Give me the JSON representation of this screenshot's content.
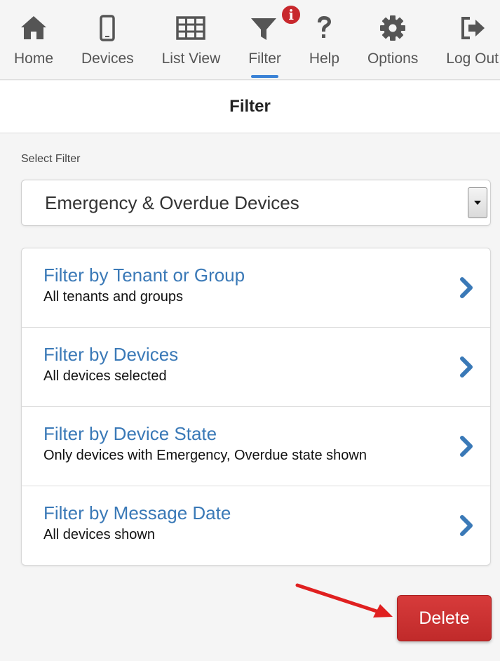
{
  "nav": {
    "items": [
      {
        "label": "Home",
        "icon": "home-icon"
      },
      {
        "label": "Devices",
        "icon": "mobile-device-icon"
      },
      {
        "label": "List View",
        "icon": "grid-table-icon"
      },
      {
        "label": "Filter",
        "icon": "filter-funnel-icon",
        "active": true,
        "badge": "i"
      },
      {
        "label": "Help",
        "icon": "question-mark-icon"
      },
      {
        "label": "Options",
        "icon": "gear-icon"
      },
      {
        "label": "Log Out",
        "icon": "sign-out-icon"
      }
    ],
    "active_color": "#3a82d6",
    "badge_color": "#c8282d"
  },
  "header": {
    "title": "Filter"
  },
  "select_filter": {
    "label": "Select Filter",
    "value": "Emergency & Overdue Devices"
  },
  "filters": [
    {
      "title": "Filter by Tenant or Group",
      "subtitle": "All tenants and groups"
    },
    {
      "title": "Filter by Devices",
      "subtitle": "All devices selected"
    },
    {
      "title": "Filter by Device State",
      "subtitle": "Only devices with Emergency, Overdue state shown"
    },
    {
      "title": "Filter by Message Date",
      "subtitle": "All devices shown"
    }
  ],
  "delete_button": {
    "label": "Delete",
    "color": "#cc3333"
  },
  "link_color": "#3a79b7"
}
